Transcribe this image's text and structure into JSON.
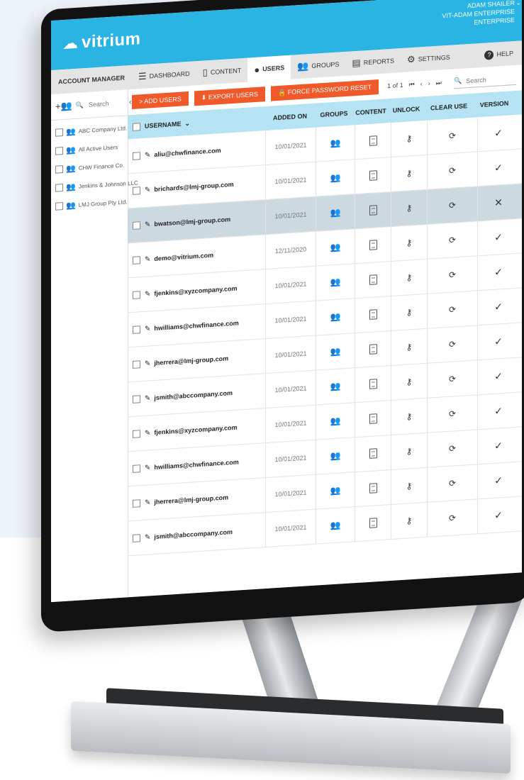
{
  "app": {
    "brand": "vitrium",
    "user_name": "ADAM SHAILER",
    "user_org": "VIT-ADAM ENTERPRISE",
    "user_plan": "ENTERPRISE"
  },
  "nav": {
    "account_manager": "ACCOUNT MANAGER",
    "items": [
      {
        "label": "DASHBOARD",
        "icon": "menu-icon"
      },
      {
        "label": "CONTENT",
        "icon": "document-icon"
      },
      {
        "label": "USERS",
        "icon": "user-icon"
      },
      {
        "label": "GROUPS",
        "icon": "group-icon"
      },
      {
        "label": "REPORTS",
        "icon": "bar-chart-icon"
      },
      {
        "label": "SETTINGS",
        "icon": "gear-icon"
      }
    ],
    "active": "USERS",
    "help": "HELP"
  },
  "sidebar": {
    "search_placeholder": "Search",
    "groups": [
      "ABC Company Ltd.",
      "All Active Users",
      "CHW Finance Co.",
      "Jenkins & Johnson LLC",
      "LMJ Group Pty Ltd."
    ]
  },
  "toolbar": {
    "add_users": "> ADD USERS",
    "export_users": "EXPORT USERS",
    "force_reset": "FORCE PASSWORD RESET",
    "page_info": "1 of 1",
    "search_placeholder": "Search"
  },
  "colors": {
    "brand": "#2ab4e4",
    "action": "#f05a2a",
    "table_header": "#b6e3f4",
    "selected_row": "#ccd9e1"
  },
  "table": {
    "headers": {
      "username": "USERNAME",
      "added_on": "ADDED ON",
      "groups": "GROUPS",
      "content": "CONTENT",
      "unlock": "UNLOCK",
      "clear_use": "CLEAR USE",
      "version": "VERSION"
    },
    "rows": [
      {
        "username": "aliu@chwfinance.com",
        "added_on": "10/01/2021",
        "version": "✓"
      },
      {
        "username": "brichards@lmj-group.com",
        "added_on": "10/01/2021",
        "version": "✓"
      },
      {
        "username": "bwatson@lmj-group.com",
        "added_on": "10/01/2021",
        "version": "✕",
        "selected": true
      },
      {
        "username": "demo@vitrium.com",
        "added_on": "12/11/2020",
        "version": "✓"
      },
      {
        "username": "fjenkins@xyzcompany.com",
        "added_on": "10/01/2021",
        "version": "✓"
      },
      {
        "username": "hwilliams@chwfinance.com",
        "added_on": "10/01/2021",
        "version": "✓"
      },
      {
        "username": "jherrera@lmj-group.com",
        "added_on": "10/01/2021",
        "version": "✓"
      },
      {
        "username": "jsmith@abccompany.com",
        "added_on": "10/01/2021",
        "version": "✓"
      },
      {
        "username": "fjenkins@xyzcompany.com",
        "added_on": "10/01/2021",
        "version": "✓"
      },
      {
        "username": "hwilliams@chwfinance.com",
        "added_on": "10/01/2021",
        "version": "✓"
      },
      {
        "username": "jherrera@lmj-group.com",
        "added_on": "10/01/2021",
        "version": "✓"
      },
      {
        "username": "jsmith@abccompany.com",
        "added_on": "10/01/2021",
        "version": "✓"
      }
    ]
  }
}
